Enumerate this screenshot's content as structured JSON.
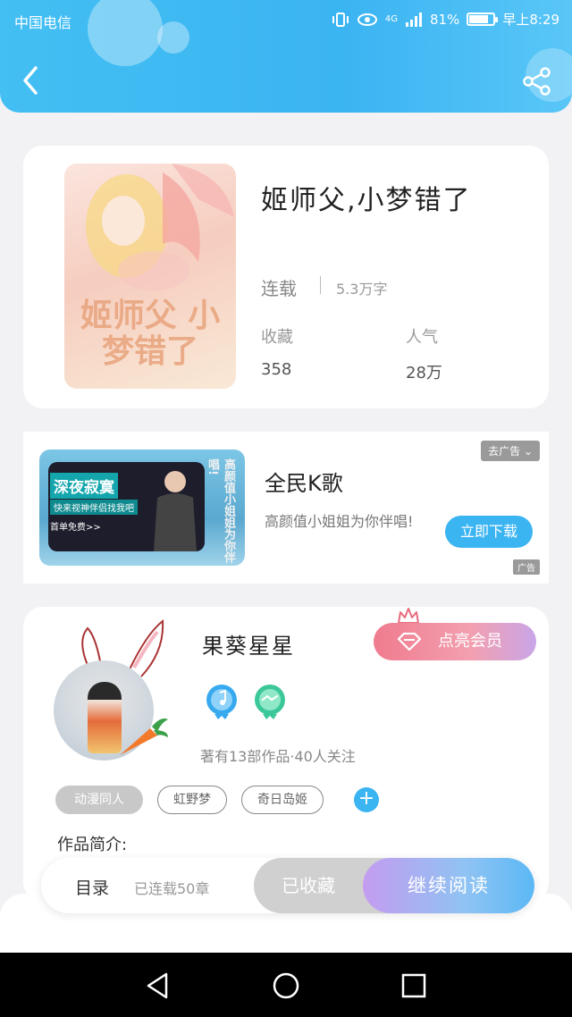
{
  "status_bar": {
    "carrier": "中国电信",
    "signal": "4G",
    "battery": "81%",
    "battery_level": 0.81,
    "time": "早上8:29"
  },
  "header": {
    "back_icon": "chevron-left-icon",
    "share_icon": "share-icon"
  },
  "book": {
    "cover_title": "姬师父 小梦错了",
    "title": "姬师父,小梦错了",
    "status": "连载",
    "word_count": "5.3万字",
    "favorites_label": "收藏",
    "favorites_value": "358",
    "popularity_label": "人气",
    "popularity_value": "28万"
  },
  "ad": {
    "image_title": "深夜寂寞",
    "image_subtitle": "快来视神伴侣找我吧",
    "image_free": "首单免费>>",
    "image_vertical": "高颜值小姐姐为你伴唱!",
    "tag": "去广告",
    "title": "全民K歌",
    "description": "高颜值小姐姐为你伴唱!",
    "download_label": "立即下载",
    "badge": "广告"
  },
  "author": {
    "name": "果葵星星",
    "vip_label": "点亮会员",
    "stats": "著有13部作品·40人关注",
    "tags": [
      "动漫同人",
      "虹野梦",
      "奇日岛姬"
    ],
    "add_tag": "+",
    "intro_label": "作品简介:"
  },
  "action_bar": {
    "toc_label": "目录",
    "toc_count": "已连载50章",
    "collected_label": "已收藏",
    "continue_label": "继续阅读"
  },
  "colors": {
    "accent": "#3bb4f2",
    "vip_pink": "#f07b8e",
    "continue_purple": "#c49cf0"
  }
}
